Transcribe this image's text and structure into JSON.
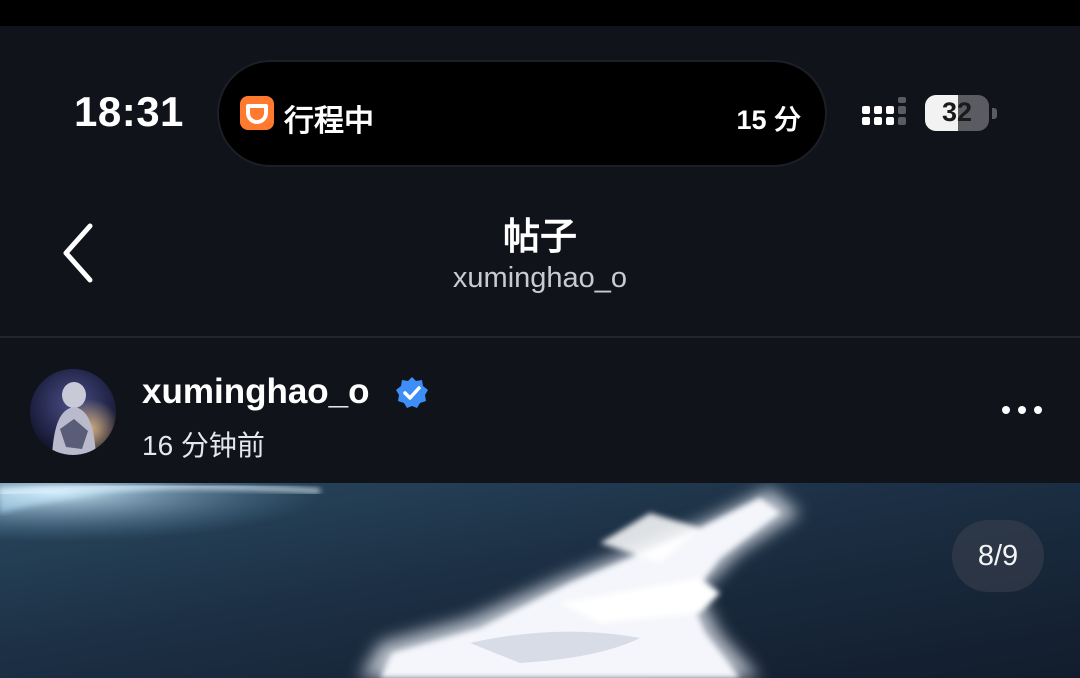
{
  "status_bar": {
    "time": "18:31",
    "island": {
      "app_icon": "didi-icon",
      "label": "行程中",
      "eta": "15 分"
    },
    "signal_icon": "cellular-signal-icon",
    "battery_level": "32"
  },
  "nav": {
    "back_icon": "chevron-left-icon",
    "title": "帖子",
    "subtitle": "xuminghao_o"
  },
  "post": {
    "username": "xuminghao_o",
    "verified_icon": "verified-badge-icon",
    "time_ago": "16 分钟前",
    "more_icon": "more-horizontal-icon",
    "page_indicator": "8/9"
  },
  "colors": {
    "background": "#10131a",
    "verified": "#3d8ef7",
    "didi_brand": "#ff7a2e",
    "text_primary": "#ffffff"
  }
}
